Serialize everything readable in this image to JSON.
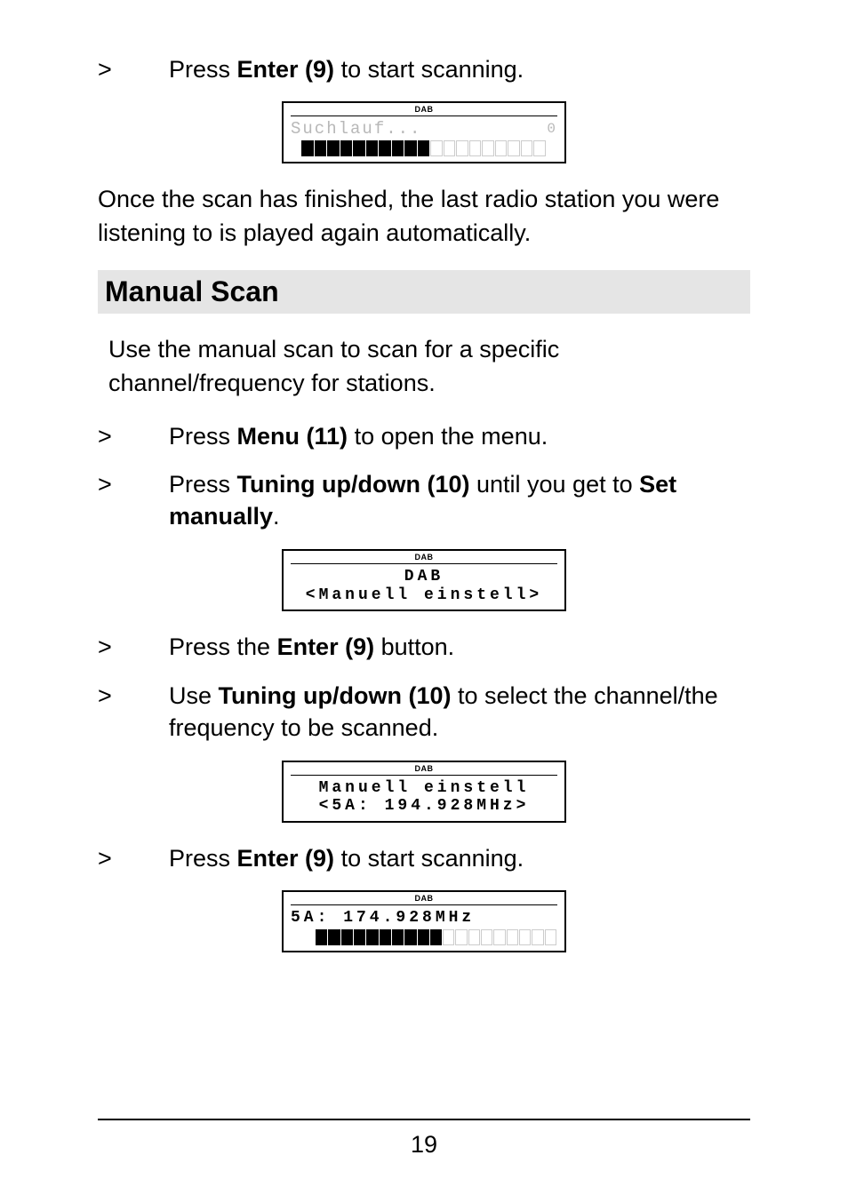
{
  "r1_chev": ">",
  "r1_a": "Press ",
  "r1_b": "Enter (9)",
  "r1_c": " to start scanning.",
  "lcd1_dab": "DAB",
  "lcd1_text": "Suchlauf...",
  "lcd1_zero": "0",
  "para1": "Once the scan has finished, the last radio station you were listening to is played again automatically.",
  "heading": "Manual Scan",
  "para2": "Use the manual scan to scan for a specific channel/frequency for stations.",
  "r2_chev": ">",
  "r2_a": "Press ",
  "r2_b": "Menu (11)",
  "r2_c": " to open the menu.",
  "r3_chev": ">",
  "r3_a": "Press ",
  "r3_b": "Tuning up/down (10)",
  "r3_c": " until you get to ",
  "r3_d": "Set manually",
  "r3_e": ".",
  "lcd2_dab": "DAB",
  "lcd2_l1": "DAB",
  "lcd2_l2": "<Manuell einstell>",
  "r4_chev": ">",
  "r4_a": "Press the ",
  "r4_b": "Enter (9)",
  "r4_c": " button.",
  "r5_chev": ">",
  "r5_a": "Use ",
  "r5_b": "Tuning up/down (10)",
  "r5_c": " to select the channel/the frequency to be scanned.",
  "lcd3_dab": "DAB",
  "lcd3_l1": "Manuell einstell",
  "lcd3_l2": "<5A: 194.928MHz>",
  "r6_chev": ">",
  "r6_a": "Press ",
  "r6_b": "Enter (9)",
  "r6_c": " to start scanning.",
  "lcd4_dab": "DAB",
  "lcd4_l1": "5A: 174.928MHz",
  "page": "19"
}
